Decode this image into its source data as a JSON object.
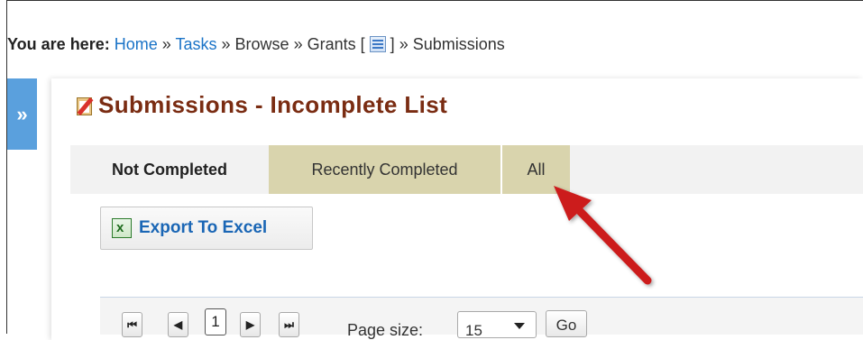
{
  "breadcrumb": {
    "lead": "You are here:",
    "home": "Home",
    "sep": "»",
    "tasks": "Tasks",
    "browse": "Browse",
    "grants": "Grants [",
    "grants_close": "]",
    "submissions": "Submissions",
    "grid_icon": "grid-icon"
  },
  "side_toggle": "»",
  "page": {
    "title": "Submissions - Incomplete List",
    "title_icon": "clipboard-icon",
    "title_color": "#7a2c12"
  },
  "tabs": [
    {
      "label": "Not Completed",
      "active": true
    },
    {
      "label": "Recently Completed",
      "active": false
    },
    {
      "label": "All",
      "active": false
    }
  ],
  "toolbar": {
    "export_label": "Export To Excel",
    "export_icon": "excel-icon"
  },
  "pager": {
    "first": "first-page-icon",
    "prev": "prev-page-icon",
    "current_page": "1",
    "next": "next-page-icon",
    "last": "last-page-icon",
    "page_size_label": "Page size:",
    "page_size_value": "15",
    "go_label": "Go"
  },
  "annotation": {
    "arrow_color": "#cc1f1f"
  },
  "colors": {
    "link": "#1a73c7",
    "side_tab": "#5aa0dd",
    "inactive_tab": "#d9d4ad"
  }
}
